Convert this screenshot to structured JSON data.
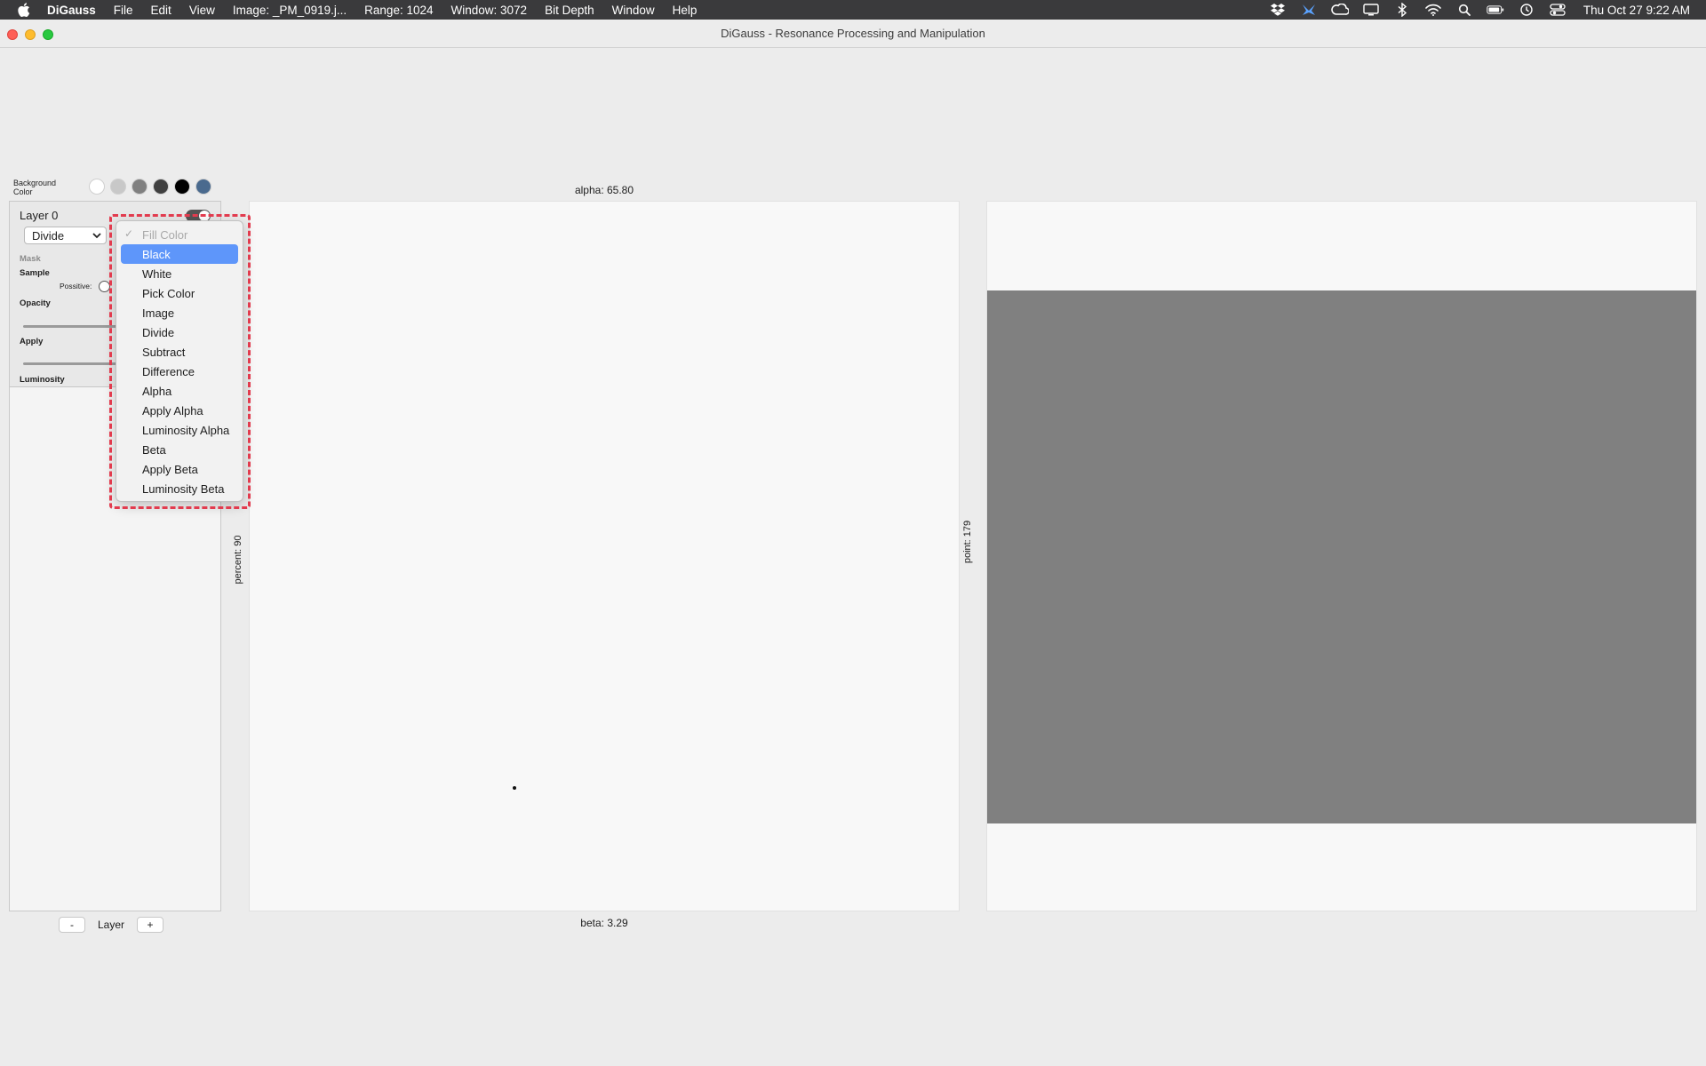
{
  "menubar": {
    "app_name": "DiGauss",
    "items": [
      "File",
      "Edit",
      "View",
      "Image: _PM_0919.j...",
      "Range: 1024",
      "Window: 3072",
      "Bit Depth",
      "Window",
      "Help"
    ],
    "clock": "Thu Oct 27  9:22 AM",
    "status_icons": [
      "dropbox-icon",
      "bird-icon",
      "creative-cloud-icon",
      "display-icon",
      "bluetooth-icon",
      "wifi-icon",
      "search-icon",
      "battery-icon",
      "time-machine-icon",
      "control-center-icon"
    ]
  },
  "window": {
    "title": "DiGauss - Resonance Processing and Manipulation"
  },
  "background": {
    "label": "Background Color",
    "swatches": [
      "#ffffff",
      "#c8c8c8",
      "#808080",
      "#404040",
      "#000000",
      "#4a6a8e"
    ]
  },
  "layer": {
    "name": "Layer 0",
    "blend_mode": "Divide",
    "mask_label": "Mask",
    "sample_label": "Sample",
    "possitive_label": "Possitive:",
    "opacity_label": "Opacity",
    "apply_label": "Apply",
    "luminosity_label": "Luminosity"
  },
  "layer_controls": {
    "minus": "-",
    "label": "Layer",
    "plus": "+"
  },
  "popup": {
    "header": "Fill Color",
    "items": [
      "Black",
      "White",
      "Pick Color",
      "Image",
      "Divide",
      "Subtract",
      "Difference",
      "Alpha",
      "Apply Alpha",
      "Luminosity Alpha",
      "Beta",
      "Apply Beta",
      "Luminosity Beta"
    ],
    "selected": "Black"
  },
  "canvas": {
    "alpha_label": "alpha: 65.80",
    "beta_label": "beta: 3.29",
    "percent_label": "percent: 90",
    "point_label": "point: 179"
  }
}
